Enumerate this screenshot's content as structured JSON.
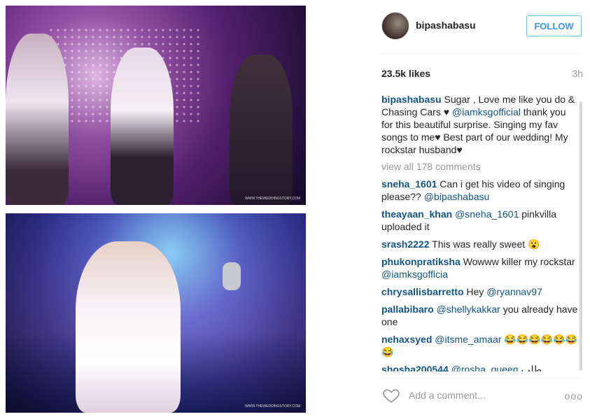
{
  "post": {
    "username": "bipashabasu",
    "follow_label": "FOLLOW",
    "likes": "23.5k likes",
    "time": "3h",
    "watermark_1": "WWW.THEWEDDINGSTORY.COM",
    "watermark_2": "WWW.THEWEDDINGSTORY.COM"
  },
  "caption": {
    "user": "bipashabasu",
    "text_1": "Sugar , Love me like you do & Chasing Cars ♥ ",
    "mention": "@iamksgofficial",
    "text_2": " thank you for this beautiful surprise. Singing my fav songs to me♥ Best part of our wedding! My rockstar husband♥"
  },
  "view_all": "view all 178 comments",
  "comments": [
    {
      "user": "sneha_1601",
      "text_1": "Can i get his video of singing please?? ",
      "mention": "@bipashabasu",
      "text_2": ""
    },
    {
      "user": "theayaan_khan",
      "text_1": "",
      "mention": "@sneha_1601",
      "text_2": " pinkvilla uploaded it"
    },
    {
      "user": "srash2222",
      "text_1": "This was really sweet 😮",
      "mention": "",
      "text_2": ""
    },
    {
      "user": "phukonpratiksha",
      "text_1": "Wowww killer my rockstar ",
      "mention": "@iamksgofficia",
      "text_2": ""
    },
    {
      "user": "chrysallisbarretto",
      "text_1": "Hey ",
      "mention": "@ryannav97",
      "text_2": ""
    },
    {
      "user": "pallabibaro",
      "text_1": "",
      "mention": "@shellykakkar",
      "text_2": " you already have one"
    },
    {
      "user": "nehaxsyed",
      "text_1": "",
      "mention": "@itsme_amaar",
      "text_2": " 😂😂😂😂😂😂 😂"
    },
    {
      "user": "shosha200544",
      "text_1": "",
      "mention": "@rosha_queen",
      "text_2": " طلب"
    }
  ],
  "footer": {
    "add_comment_placeholder": "Add a comment...",
    "more_label": "ooo"
  }
}
